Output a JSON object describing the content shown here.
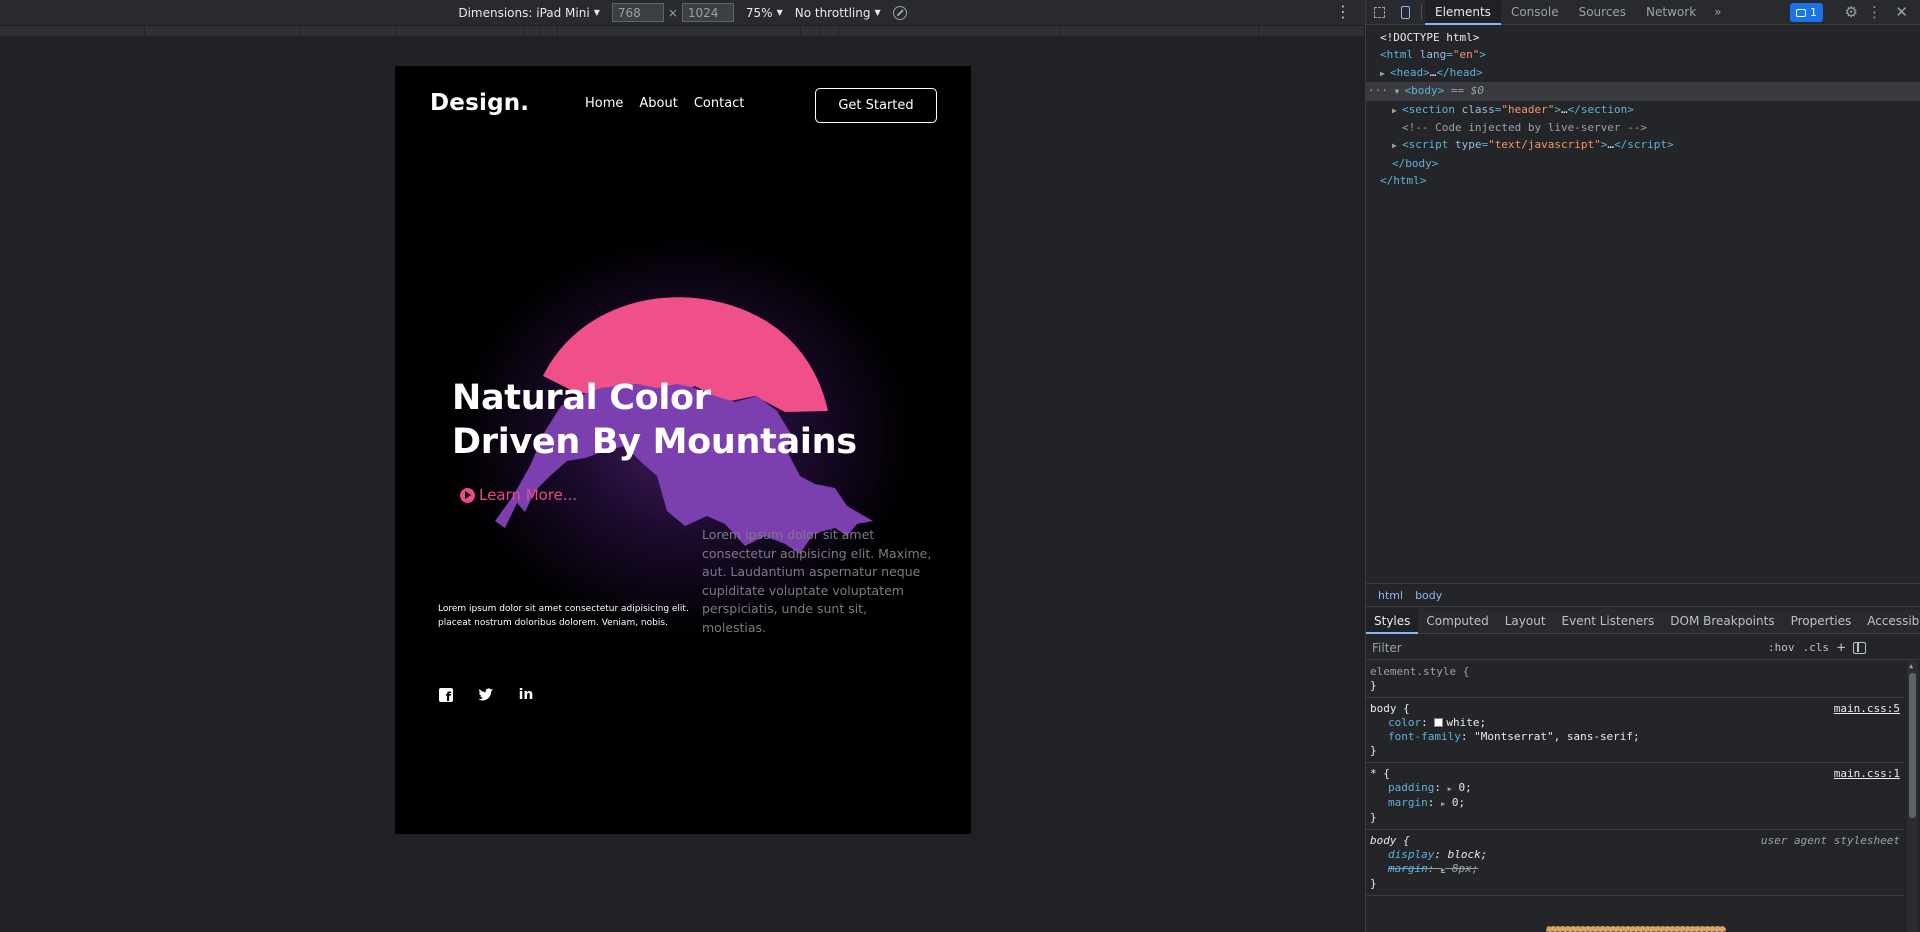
{
  "device_toolbar": {
    "dimensions_label": "Dimensions: iPad Mini",
    "width_value": "768",
    "height_value": "1024",
    "times": "×",
    "zoom": "75%",
    "throttling": "No throttling",
    "kebab": "⋮"
  },
  "site": {
    "logo": "Design.",
    "nav": [
      "Home",
      "About",
      "Contact"
    ],
    "cta": "Get Started",
    "hero_title_line1": "Natural Color",
    "hero_title_line2": "Driven By Mountains",
    "learn_more": "Learn More...",
    "desc_right": "Lorem ipsum dolor sit amet consectetur adipisicing elit. Maxime, aut. Laudantium aspernatur neque cupiditate voluptate voluptatem perspiciatis, unde sunt sit, molestias.",
    "desc_left": "Lorem ipsum dolor sit amet consectetur adipisicing elit. placeat nostrum doloribus dolorem. Veniam, nobis.",
    "socials": [
      "facebook",
      "twitter",
      "linkedin"
    ],
    "accent_color": "#e84a8a",
    "mountain_color": "#7b3fb0",
    "sun_color": "#f0508a"
  },
  "devtools": {
    "tabs": [
      "Elements",
      "Console",
      "Sources",
      "Network"
    ],
    "active_tab": "Elements",
    "more": "»",
    "issues_count": "1",
    "dom": {
      "doctype": "<!DOCTYPE html>",
      "html_open_tag": "html",
      "lang_attr": "lang",
      "lang_val": "\"en\"",
      "head": "head",
      "head_ellipsis": "…",
      "body": "body",
      "body_marker": "== $0",
      "section_tag": "section",
      "class_attr": "class",
      "class_val": "\"header\"",
      "comment": "<!-- Code injected by live-server -->",
      "script_tag": "script",
      "type_attr": "type",
      "type_val": "\"text/javascript\"",
      "body_close": "</body>",
      "html_close": "</html>"
    },
    "breadcrumbs": [
      "html",
      "body"
    ],
    "pane_tabs": [
      "Styles",
      "Computed",
      "Layout",
      "Event Listeners",
      "DOM Breakpoints",
      "Properties",
      "Accessibility"
    ],
    "filter_placeholder": "Filter",
    "hov": ":hov",
    "cls": ".cls",
    "rules": {
      "r1_selector": "element.style {",
      "r2_selector": "body {",
      "r2_source": "main.css:5",
      "r2_color_name": "color",
      "r2_color_val": "white;",
      "r2_font_name": "font-family",
      "r2_font_val": "\"Montserrat\", sans-serif;",
      "r3_selector": "* {",
      "r3_source": "main.css:1",
      "r3_padding_name": "padding",
      "r3_padding_val": "0;",
      "r3_margin_name": "margin",
      "r3_margin_val": "0;",
      "r4_selector": "body {",
      "r4_source": "user agent stylesheet",
      "r4_display_name": "display",
      "r4_display_val": "block;",
      "r4_margin_name": "margin",
      "r4_margin_val": "8px;",
      "close": "}"
    }
  }
}
